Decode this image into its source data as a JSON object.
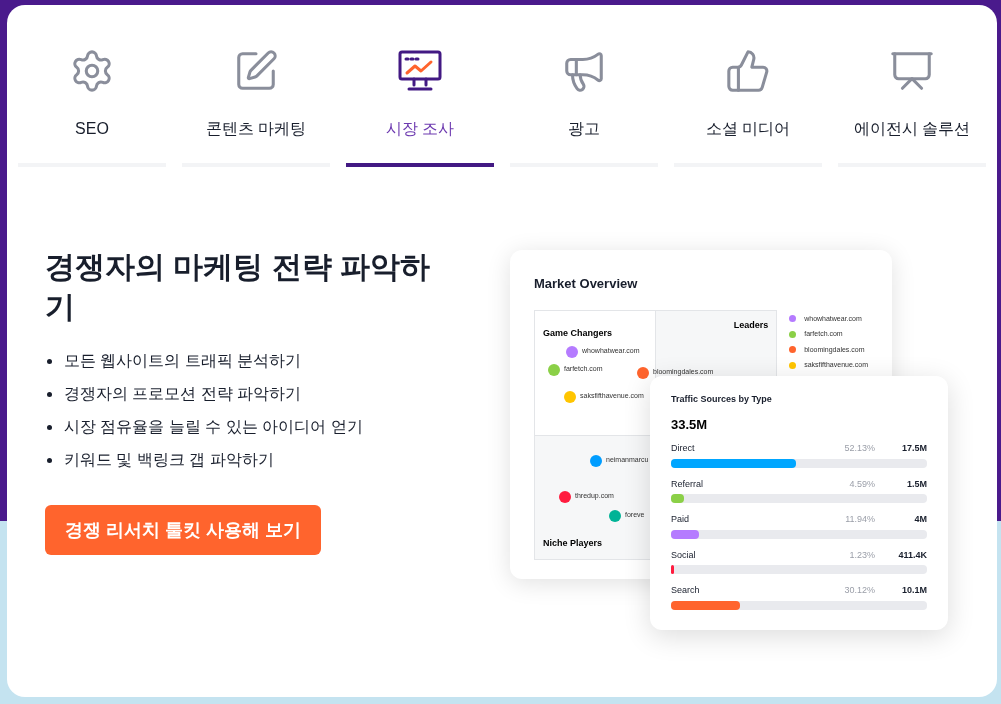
{
  "tabs": [
    {
      "label": "SEO",
      "selected": false
    },
    {
      "label": "콘텐츠 마케팅",
      "selected": false
    },
    {
      "label": "시장 조사",
      "selected": true
    },
    {
      "label": "광고",
      "selected": false
    },
    {
      "label": "소셜 미디어",
      "selected": false
    },
    {
      "label": "에이전시 솔루션",
      "selected": false
    }
  ],
  "heading": "경쟁자의 마케팅 전략 파악하기",
  "bullets": [
    "모든 웹사이트의 트래픽 분석하기",
    "경쟁자의 프로모션 전략 파악하기",
    "시장 점유율을 늘릴 수 있는 아이디어 얻기",
    "키워드 및 백링크 갭 파악하기"
  ],
  "cta": "경쟁 리서치 툴킷 사용해 보기",
  "market_overview": {
    "title": "Market Overview",
    "quadrants": [
      "Game Changers",
      "Leaders",
      "Niche Players"
    ],
    "points": [
      {
        "label": "whowhatwear.com",
        "color": "#b57bff"
      },
      {
        "label": "farfetch.com",
        "color": "#8bd047"
      },
      {
        "label": "bloomingdales.com",
        "color": "#ff642d"
      },
      {
        "label": "saksfifthavenue.com",
        "color": "#ffc500"
      },
      {
        "label": "neimanmarcu",
        "color": "#009dff"
      },
      {
        "label": "thredup.com",
        "color": "#ff1c3f"
      },
      {
        "label": "foreve",
        "color": "#00b396"
      }
    ],
    "legend": [
      {
        "label": "whowhatwear.com",
        "color": "#b57bff"
      },
      {
        "label": "farfetch.com",
        "color": "#8bd047"
      },
      {
        "label": "bloomingdales.com",
        "color": "#ff642d"
      },
      {
        "label": "saksfifthavenue.com",
        "color": "#ffc500"
      }
    ]
  },
  "traffic_sources": {
    "title": "Traffic Sources by Type",
    "total": "33.5M",
    "rows": [
      {
        "name": "Direct",
        "share": "52.13%",
        "value": "17.5M",
        "level": 0.49,
        "color": "#00a6ff"
      },
      {
        "name": "Referral",
        "share": "4.59%",
        "value": "1.5M",
        "level": 0.05,
        "color": "#8bd047"
      },
      {
        "name": "Paid",
        "share": "11.94%",
        "value": "4M",
        "level": 0.11,
        "color": "#b57bff"
      },
      {
        "name": "Social",
        "share": "1.23%",
        "value": "411.4K",
        "level": 0.01,
        "color": "#ff1c3f"
      },
      {
        "name": "Search",
        "share": "30.12%",
        "value": "10.1M",
        "level": 0.27,
        "color": "#ff642d"
      }
    ]
  }
}
